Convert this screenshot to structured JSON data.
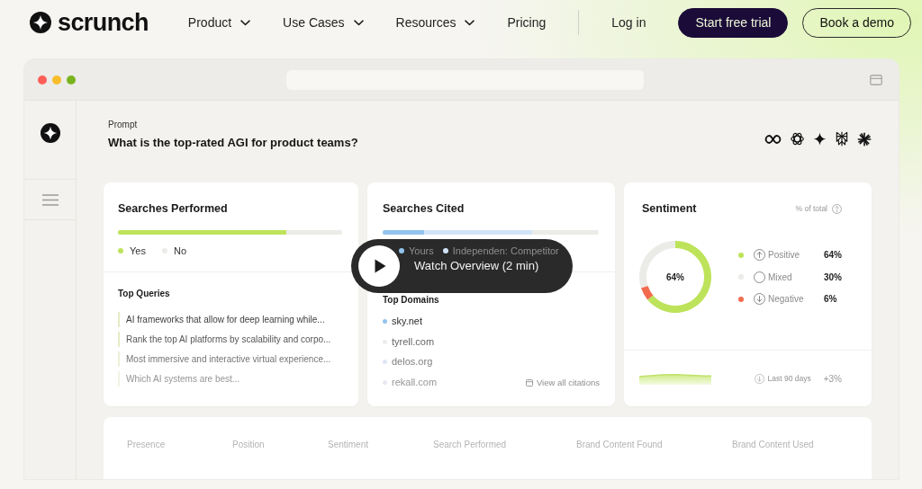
{
  "nav": {
    "logo": "scrunch",
    "links": [
      {
        "label": "Product",
        "dropdown": true
      },
      {
        "label": "Use Cases",
        "dropdown": true
      },
      {
        "label": "Resources",
        "dropdown": true
      },
      {
        "label": "Pricing",
        "dropdown": false
      }
    ],
    "login": "Log in",
    "buttons": [
      {
        "label": "Start free trial",
        "kind": "primary"
      },
      {
        "label": "Book a demo",
        "kind": "outline"
      }
    ]
  },
  "prompt": {
    "label": "Prompt",
    "question": "What is the top-rated AGI for product teams?"
  },
  "searches_performed": {
    "title": "Searches Performed",
    "level": 0.75,
    "legend": [
      {
        "label": "Yes",
        "color": "#bde35b"
      },
      {
        "label": "No",
        "color": "#ebebe8"
      }
    ],
    "list_title": "Top Queries",
    "queries": [
      "AI frameworks that allow for deep learning while...",
      "Rank the top AI platforms by scalability and corpo...",
      "Most immersive and interactive virtual experience...",
      "Which AI systems are best..."
    ]
  },
  "searches_cited": {
    "title": "Searches Cited",
    "segments": [
      {
        "level": 0.19
      },
      {
        "level": 0.69
      }
    ],
    "legend": [
      {
        "label": "Yours",
        "color": "#93c3ee"
      },
      {
        "label": "Independen: Competitor",
        "color": "#d2e4f7"
      }
    ],
    "list_title": "Top Domains",
    "domains": [
      {
        "name": "sky.net",
        "color": "#93c3ee"
      },
      {
        "name": "tyrell.com",
        "color": "#ececec"
      },
      {
        "name": "delos.org",
        "color": "#dfe6f4"
      },
      {
        "name": "rekall.com",
        "color": "#e6e9f3"
      }
    ],
    "link": "View all citations"
  },
  "sentiment": {
    "title": "Sentiment",
    "note": "% of total",
    "chart_data": {
      "type": "donut",
      "values": [
        64,
        30,
        6
      ]
    },
    "center_label": "64%",
    "legend": [
      {
        "label": "Positive",
        "kind": "up",
        "color": "#bde35b",
        "value": "64%"
      },
      {
        "label": "Mixed",
        "kind": "neutral",
        "color": "#ebebe8",
        "value": "30%"
      },
      {
        "label": "Negative",
        "kind": "down",
        "color": "#f26b4f",
        "value": "6%"
      }
    ],
    "footer": {
      "period": "Last 90 days",
      "change": "+3%"
    }
  },
  "details_table": {
    "columns": [
      "Presence",
      "Position",
      "Sentiment",
      "Search Performed",
      "Brand Content Found",
      "Brand Content Used"
    ]
  },
  "video_button": {
    "label": "Watch Overview (2 min)"
  }
}
